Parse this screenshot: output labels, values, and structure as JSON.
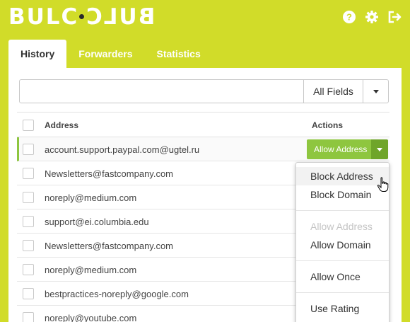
{
  "app": {
    "logo_left": "BULC",
    "logo_right": "BULC"
  },
  "header_icons": [
    "help-icon",
    "gear-icon",
    "logout-icon"
  ],
  "colors": {
    "background": "#d1dc29",
    "accent_green": "#8ec63f",
    "accent_dark": "#6fa52a"
  },
  "tabs": [
    {
      "label": "History",
      "active": true
    },
    {
      "label": "Forwarders",
      "active": false
    },
    {
      "label": "Statistics",
      "active": false
    }
  ],
  "search": {
    "value": "",
    "placeholder": "",
    "field_selected": "All Fields"
  },
  "table": {
    "columns": {
      "address": "Address",
      "actions": "Actions"
    },
    "rows": [
      "account.support.paypal.com@ugtel.ru",
      "Newsletters@fastcompany.com",
      "noreply@medium.com",
      "support@ei.columbia.edu",
      "Newsletters@fastcompany.com",
      "noreply@medium.com",
      "bestpractices-noreply@google.com",
      "noreply@youtube.com"
    ],
    "row_action_label": "Allow Address"
  },
  "dropdown": {
    "items": [
      {
        "label": "Block Address",
        "state": "hover"
      },
      {
        "label": "Block Domain",
        "state": "normal"
      },
      {
        "label": "Allow Address",
        "state": "disabled"
      },
      {
        "label": "Allow Domain",
        "state": "normal"
      },
      {
        "label": "Allow Once",
        "state": "normal"
      },
      {
        "label": "Use Rating",
        "state": "normal"
      }
    ]
  }
}
